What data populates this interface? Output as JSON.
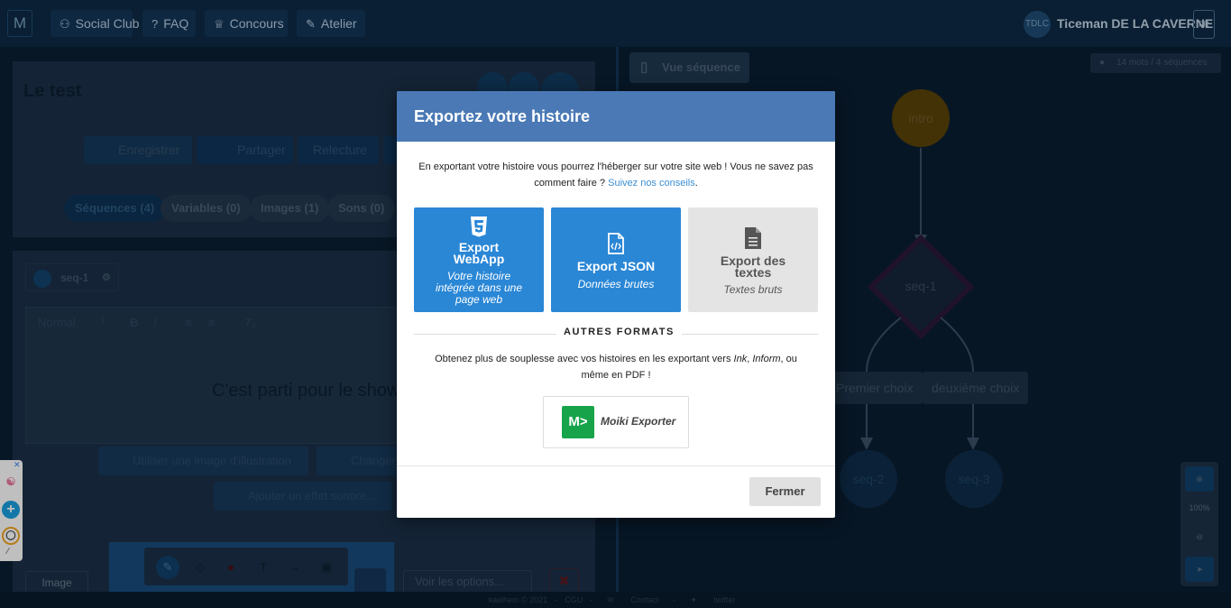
{
  "topbar": {
    "logo": "M",
    "nav": [
      {
        "icon": "users-icon",
        "label": "Social Club"
      },
      {
        "icon": "question-icon",
        "label": "FAQ"
      },
      {
        "icon": "trophy-icon",
        "label": "Concours"
      },
      {
        "icon": "pencil-icon",
        "label": "Atelier"
      }
    ],
    "avatar_initials": "TDLC",
    "username": "Ticeman DE LA CAVERNE",
    "lang": "FR"
  },
  "editor": {
    "story_title": "Le test",
    "toolbar": [
      "Enregistrer",
      "Partager",
      "Relecture"
    ],
    "tabs": [
      "Séquences (4)",
      "Variables (0)",
      "Images (1)",
      "Sons (0)"
    ],
    "sequence_tag": "seq-1",
    "format_select": "Normal",
    "content": "C'est parti pour le show",
    "illustration_button": "Utiliser une image d'illustration",
    "change_button": "Changer",
    "sound_button": "Ajouter un effet sonore...",
    "image_button": "Image",
    "options_button": "Voir les options..."
  },
  "graph": {
    "view_button": "Vue séquence",
    "stats": "14 mots / 4 séquences",
    "nodes": {
      "intro": "intro",
      "seq1": "seq-1",
      "seq2": "seq-2",
      "seq3": "seq-3"
    },
    "choices": [
      "Premier choix",
      "deuxième choix"
    ],
    "zoom_level": "100%"
  },
  "footer": [
    "kaelhem © 2021",
    "CGU",
    "Contact",
    "twitter"
  ],
  "modal": {
    "title": "Exportez votre histoire",
    "intro": "En exportant votre histoire vous pourrez l'héberger sur votre site web ! Vous ne savez pas comment faire ?",
    "intro_link": "Suivez nos conseils",
    "intro_end": ".",
    "cards": [
      {
        "icon": "html5-icon",
        "title": "Export WebApp",
        "subtitle": "Votre histoire intégrée dans une page web",
        "color": "#2a87d6"
      },
      {
        "icon": "json-file-icon",
        "title": "Export JSON",
        "subtitle": "Données brutes",
        "color": "#2a87d6"
      },
      {
        "icon": "text-file-icon",
        "title": "Export des textes",
        "subtitle": "Textes bruts",
        "color": "#e4e4e4"
      }
    ],
    "other_formats_title": "AUTRES FORMATS",
    "other_formats_text": "Obtenez plus de souplesse avec vos histoires en les exportant vers",
    "format_ink": "Ink",
    "format_inform": "Inform",
    "other_formats_end": ", ou même en PDF !",
    "exporter_logo": "M>",
    "exporter_label": "Moiki Exporter",
    "close_button": "Fermer"
  }
}
